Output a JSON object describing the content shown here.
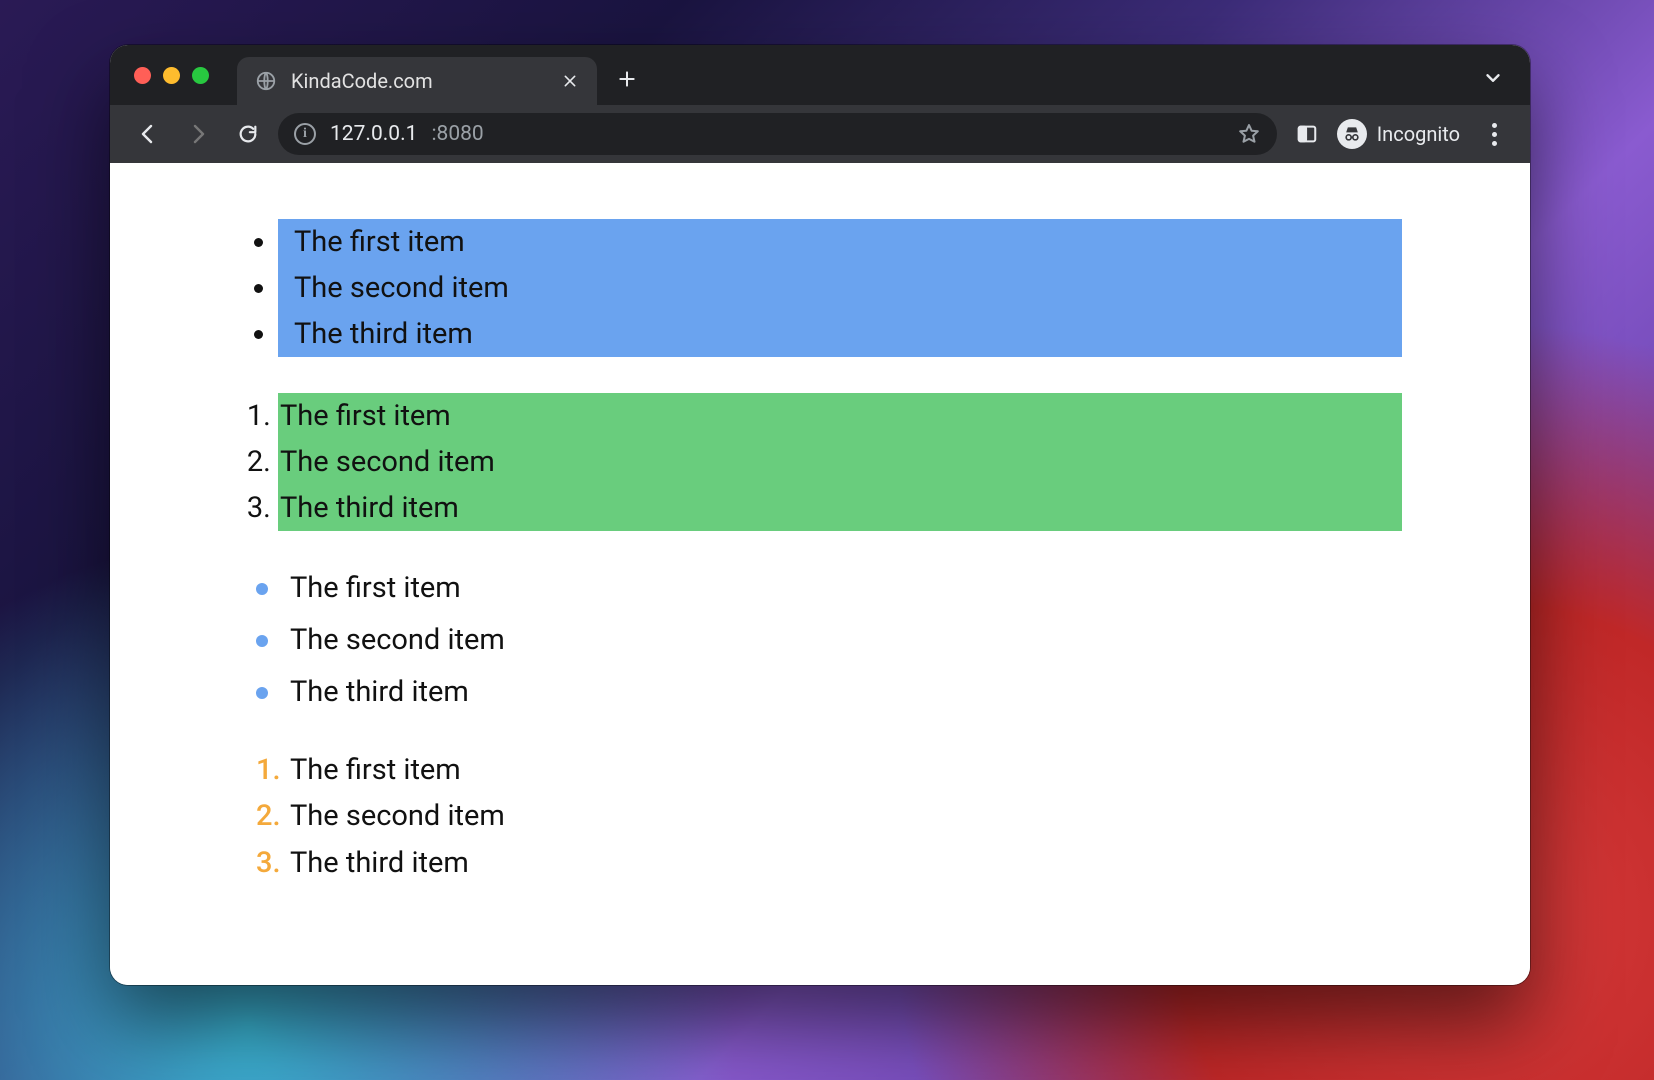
{
  "window": {
    "tab_title": "KindaCode.com",
    "new_tab_tooltip": "New Tab"
  },
  "toolbar": {
    "url_host": "127.0.0.1",
    "url_port": ":8080",
    "incognito_label": "Incognito"
  },
  "lists": {
    "blue": {
      "items": [
        "The first item",
        "The second item",
        "The third item"
      ]
    },
    "green": {
      "items": [
        "The first item",
        "The second item",
        "The third item"
      ]
    },
    "bluedot": {
      "items": [
        "The first item",
        "The second item",
        "The third item"
      ]
    },
    "orange": {
      "items": [
        "The first item",
        "The second item",
        "The third item"
      ]
    }
  },
  "colors": {
    "blue_bg": "#6aa3ef",
    "green_bg": "#69cd7d",
    "bluedot_marker": "#6aa3ef",
    "orange_marker": "#f4a93b"
  }
}
